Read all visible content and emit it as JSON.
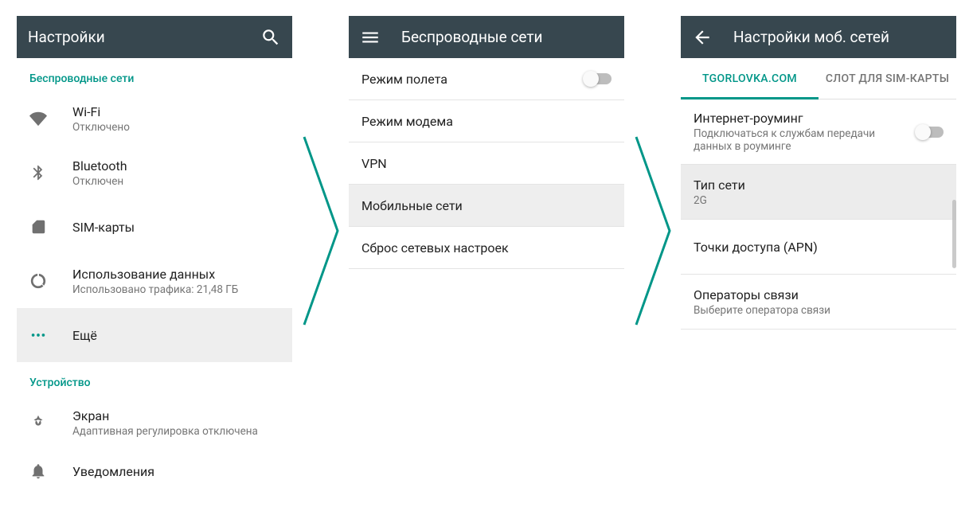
{
  "screen1": {
    "title": "Настройки",
    "sections": {
      "wireless_header": "Беспроводные сети",
      "device_header": "Устройство"
    },
    "items": {
      "wifi": {
        "label": "Wi-Fi",
        "sub": "Отключено"
      },
      "bluetooth": {
        "label": "Bluetooth",
        "sub": "Отключен"
      },
      "sim": {
        "label": "SIM-карты"
      },
      "data": {
        "label": "Использование данных",
        "sub": "Использовано трафика: 21,48 ГБ"
      },
      "more": {
        "label": "Ещё"
      },
      "display": {
        "label": "Экран",
        "sub": "Адаптивная регулировка отключена"
      },
      "notifications": {
        "label": "Уведомления"
      }
    }
  },
  "screen2": {
    "title": "Беспроводные сети",
    "items": {
      "airplane": "Режим полета",
      "tether": "Режим модема",
      "vpn": "VPN",
      "mobile": "Мобильные сети",
      "reset": "Сброс сетевых настроек"
    }
  },
  "screen3": {
    "title": "Настройки моб. сетей",
    "tabs": {
      "a": "TGORLOVKA.COM",
      "b": "СЛОТ ДЛЯ SIM-КАРТЫ"
    },
    "items": {
      "roaming": {
        "label": "Интернет-роуминг",
        "sub": "Подключаться к службам передачи данных в роуминге"
      },
      "nettype": {
        "label": "Тип сети",
        "sub": "2G"
      },
      "apn": {
        "label": "Точки доступа (APN)"
      },
      "operators": {
        "label": "Операторы связи",
        "sub": "Выберите оператора связи"
      }
    }
  }
}
